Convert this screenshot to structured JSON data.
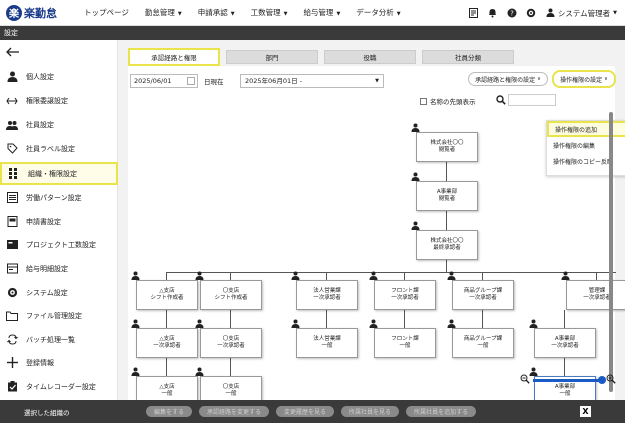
{
  "app": {
    "logo_mark": "楽",
    "logo_text": "楽勤怠"
  },
  "nav": {
    "items": [
      {
        "label": "トップページ",
        "caret": false
      },
      {
        "label": "勤怠管理",
        "caret": true
      },
      {
        "label": "申請承認",
        "caret": true
      },
      {
        "label": "工数管理",
        "caret": true
      },
      {
        "label": "給与管理",
        "caret": true
      },
      {
        "label": "データ分析",
        "caret": true
      }
    ],
    "user_label": "システム管理者"
  },
  "page_title": "設定",
  "sidebar": {
    "items": [
      {
        "label": "個人設定",
        "icon": "person-icon",
        "active": false
      },
      {
        "label": "権限委譲設定",
        "icon": "arrows-icon",
        "active": false
      },
      {
        "label": "社員設定",
        "icon": "people-icon",
        "active": false
      },
      {
        "label": "社員ラベル設定",
        "icon": "tag-icon",
        "active": false
      },
      {
        "label": "組織・権限設定",
        "icon": "org-icon",
        "active": true
      },
      {
        "label": "労働パターン設定",
        "icon": "list-icon",
        "active": false
      },
      {
        "label": "申請書設定",
        "icon": "document-icon",
        "active": false
      },
      {
        "label": "プロジェクト工数設定",
        "icon": "project-icon",
        "active": false
      },
      {
        "label": "給与明細設定",
        "icon": "payslip-icon",
        "active": false
      },
      {
        "label": "システム設定",
        "icon": "gear-icon",
        "active": false
      },
      {
        "label": "ファイル管理設定",
        "icon": "folder-icon",
        "active": false
      },
      {
        "label": "バッチ処理一覧",
        "icon": "batch-icon",
        "active": false
      },
      {
        "label": "登録情報",
        "icon": "plus-icon",
        "active": false
      },
      {
        "label": "タイムレコーダー設定",
        "icon": "recorder-icon",
        "active": false
      }
    ]
  },
  "tabs": [
    "承認経路と権限",
    "部門",
    "役職",
    "社員分類"
  ],
  "toolbar": {
    "date_value": "2025/06/01",
    "current_label": "日現在",
    "org_select_value": "2025年06月01日 -",
    "route_button": "承認経路と権限の設定",
    "perm_button": "操作権限の設定",
    "head_display_label": "名称の先頭表示"
  },
  "dropdown": {
    "items": [
      "操作権限の追加",
      "操作権限の編集",
      "操作権限のコピー反映"
    ]
  },
  "org_nodes": [
    {
      "line1": "株式会社〇〇",
      "line2": "閲覧者"
    },
    {
      "line1": "A事業部",
      "line2": "閲覧者"
    },
    {
      "line1": "株式会社〇〇",
      "line2": "最終承認者"
    },
    {
      "line1": "△支店",
      "line2": "シフト作成者"
    },
    {
      "line1": "〇支店",
      "line2": "シフト作成者"
    },
    {
      "line1": "法人営業課",
      "line2": "一次承認者"
    },
    {
      "line1": "フロント課",
      "line2": "一次承認者"
    },
    {
      "line1": "商品グループ課",
      "line2": "一次承認者"
    },
    {
      "line1": "管理課",
      "line2": "一次承認者"
    },
    {
      "line1": "△支店",
      "line2": "一次承認者"
    },
    {
      "line1": "〇支店",
      "line2": "一次承認者"
    },
    {
      "line1": "法人営業課",
      "line2": "一般"
    },
    {
      "line1": "フロント課",
      "line2": "一般"
    },
    {
      "line1": "商品グループ課",
      "line2": "一般"
    },
    {
      "line1": "A事業部",
      "line2": "一次承認者"
    },
    {
      "line1": "△支店",
      "line2": "一般"
    },
    {
      "line1": "〇支店",
      "line2": "一般"
    },
    {
      "line1": "A事業部",
      "line2": "一般"
    }
  ],
  "bottom": {
    "selected_label": "選択した組織の",
    "buttons": [
      "編集をする",
      "承認経路を変更する",
      "変更履歴を見る",
      "所属社員を見る",
      "所属社員を追加する"
    ]
  },
  "colors": {
    "brand": "#1a3a8a",
    "highlight": "#e8e44a",
    "accent_blue": "#1a5bc4",
    "dark_bar": "#3a3a3a"
  }
}
